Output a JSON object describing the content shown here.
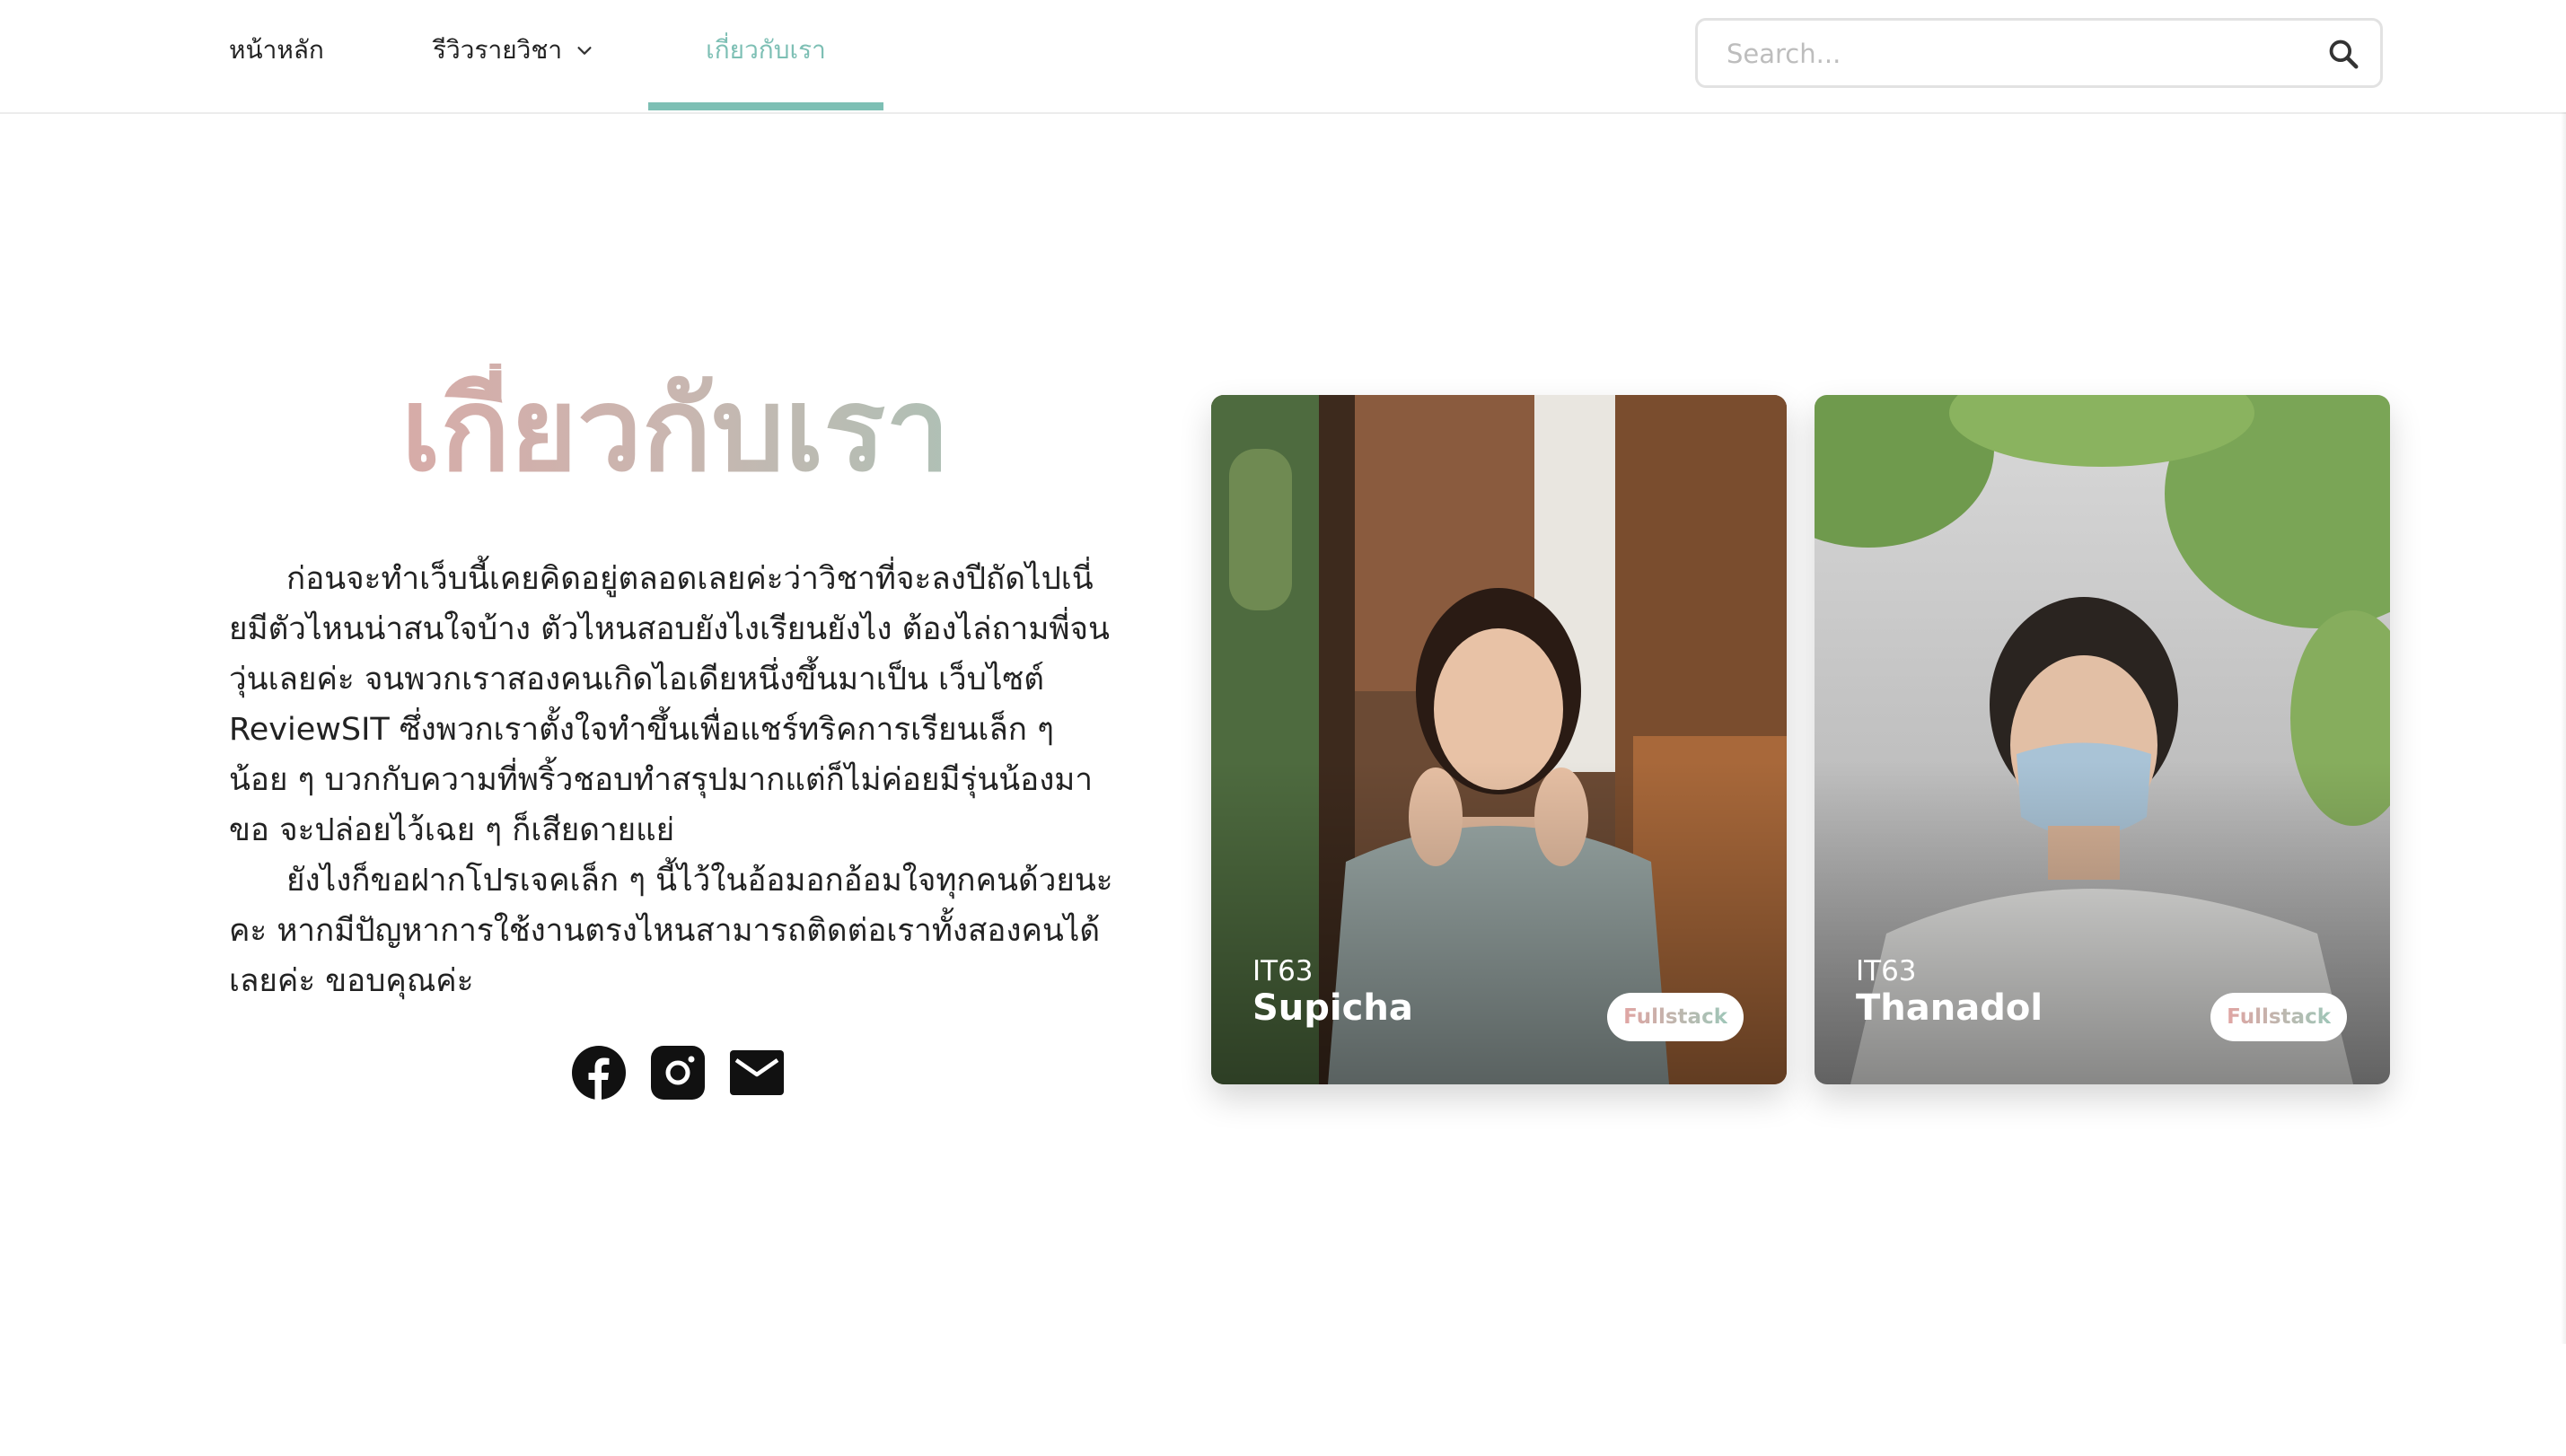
{
  "nav": {
    "items": [
      {
        "label": "หน้าหลัก"
      },
      {
        "label": "รีวิวรายวิชา"
      },
      {
        "label": "เกี่ยวกับเรา"
      }
    ],
    "active_color": "#7dbfb4",
    "search": {
      "placeholder": "Search..."
    }
  },
  "about": {
    "title": "เกี่ยวกับเรา",
    "paragraphs": [
      "ก่อนจะทำเว็บนี้เคยคิดอยู่ตลอดเลยค่ะว่าวิชาที่จะลงปีถัดไปเนี่ยมีตัวไหนน่าสนใจบ้าง ตัวไหนสอบยังไงเรียนยังไง ต้องไล่ถามพี่จนวุ่นเลยค่ะ จนพวกเราสองคนเกิดไอเดียหนึ่งขึ้นมาเป็น เว็บไซต์ ReviewSIT ซึ่งพวกเราตั้งใจทำขึ้นเพื่อแชร์ทริคการเรียนเล็ก ๆ น้อย ๆ บวกกับความที่พริ้วชอบทำสรุปมากแต่ก็ไม่ค่อยมีรุ่นน้องมาขอ จะปล่อยไว้เฉย ๆ ก็เสียดายแย่",
      "ยังไงก็ขอฝากโปรเจคเล็ก ๆ นี้ไว้ในอ้อมอกอ้อมใจทุกคนด้วยนะคะ หากมีปัญหาการใช้งานตรงไหนสามารถติดต่อเราทั้งสองคนได้เลยค่ะ ขอบคุณค่ะ"
    ],
    "gradient": [
      "#e0a5a3",
      "#9fc6b8"
    ],
    "socials": [
      "facebook-icon",
      "instagram-icon",
      "mail-icon"
    ]
  },
  "members": [
    {
      "generation": "IT63",
      "name": "Supicha",
      "role": "Fullstack"
    },
    {
      "generation": "IT63",
      "name": "Thanadol",
      "role": "Fullstack"
    }
  ]
}
